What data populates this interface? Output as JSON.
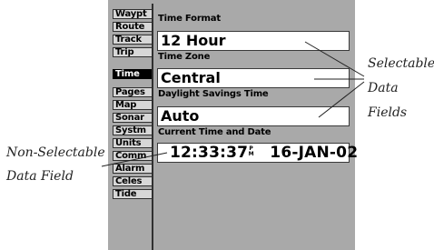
{
  "tabs": [
    {
      "label": "Waypt",
      "active": false
    },
    {
      "label": "Route",
      "active": false
    },
    {
      "label": "Track",
      "active": false
    },
    {
      "label": "Trip",
      "active": false
    },
    {
      "label": "Time",
      "active": true
    },
    {
      "label": "Pages",
      "active": false
    },
    {
      "label": "Map",
      "active": false
    },
    {
      "label": "Sonar",
      "active": false
    },
    {
      "label": "Systm",
      "active": false
    },
    {
      "label": "Units",
      "active": false
    },
    {
      "label": "Comm",
      "active": false
    },
    {
      "label": "Alarm",
      "active": false
    },
    {
      "label": "Celes",
      "active": false
    },
    {
      "label": "Tide",
      "active": false
    }
  ],
  "time_format": {
    "label": "Time Format",
    "value": "12 Hour"
  },
  "time_zone": {
    "label": "Time Zone",
    "value": "Central"
  },
  "dst": {
    "label": "Daylight Savings Time",
    "value": "Auto"
  },
  "current": {
    "label": "Current Time and Date",
    "time": "12:33:37",
    "ampm_top": "P",
    "ampm_bottom": "M",
    "date": "16-JAN-02"
  },
  "annotations": {
    "selectable_line1": "Selectable",
    "selectable_line2": "Data",
    "selectable_line3": "Fields",
    "nonselectable_line1": "Non-Selectable",
    "nonselectable_line2": "Data Field"
  }
}
